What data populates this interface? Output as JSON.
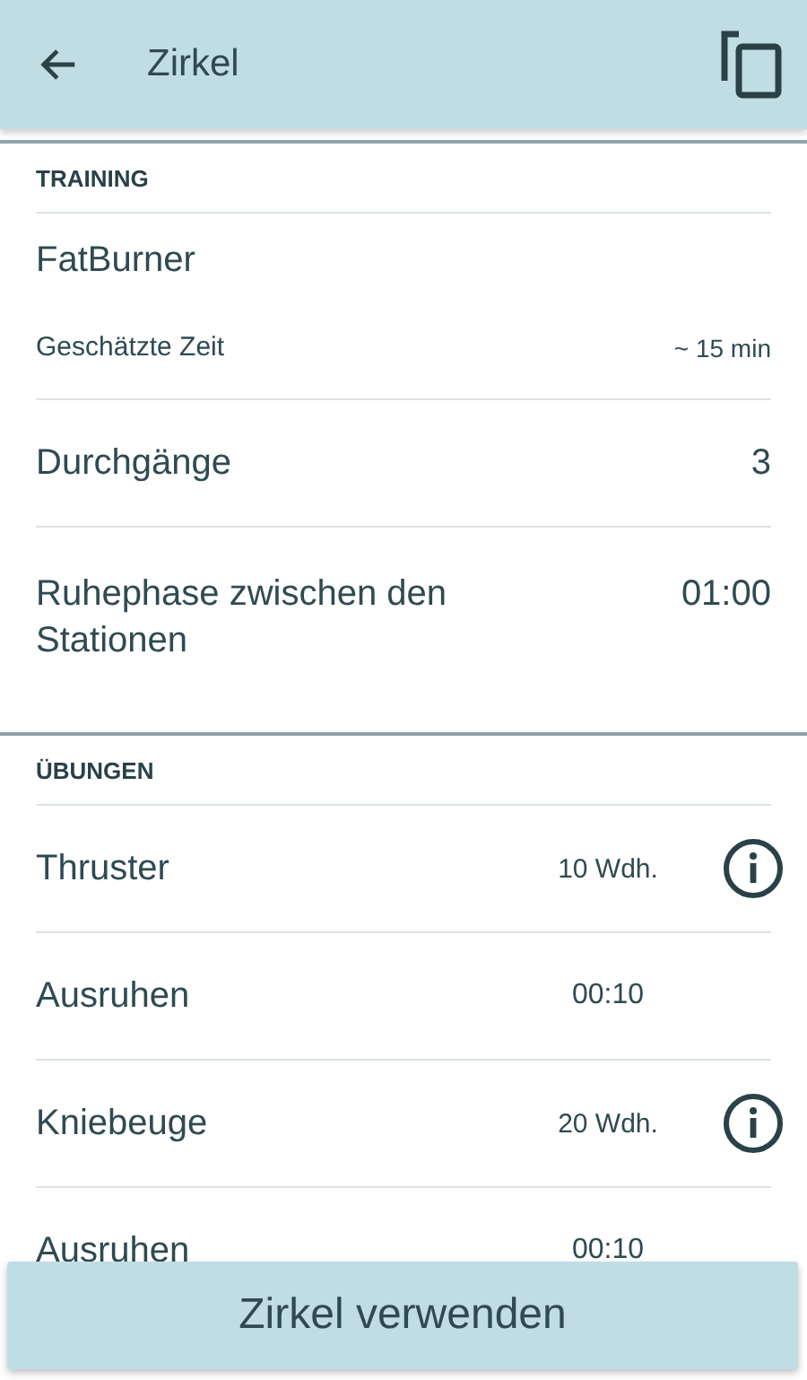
{
  "app_bar": {
    "title": "Zirkel"
  },
  "training": {
    "heading": "TRAINING",
    "name": "FatBurner",
    "estimate_label": "Geschätzte Zeit",
    "estimate_value": "~ 15 min",
    "settings": [
      {
        "label": "Durchgänge",
        "value": "3"
      },
      {
        "label": "Ruhephase zwischen den Stationen",
        "value": "01:00"
      }
    ]
  },
  "exercises": {
    "heading": "ÜBUNGEN",
    "items": [
      {
        "kind": "exercise",
        "name": "Thruster",
        "value": "10 Wdh."
      },
      {
        "kind": "rest",
        "name": "Ausruhen",
        "value": "00:10"
      },
      {
        "kind": "exercise",
        "name": "Kniebeuge",
        "value": "20 Wdh."
      },
      {
        "kind": "rest",
        "name": "Ausruhen",
        "value": "00:10"
      }
    ]
  },
  "action_button": "Zirkel verwenden"
}
